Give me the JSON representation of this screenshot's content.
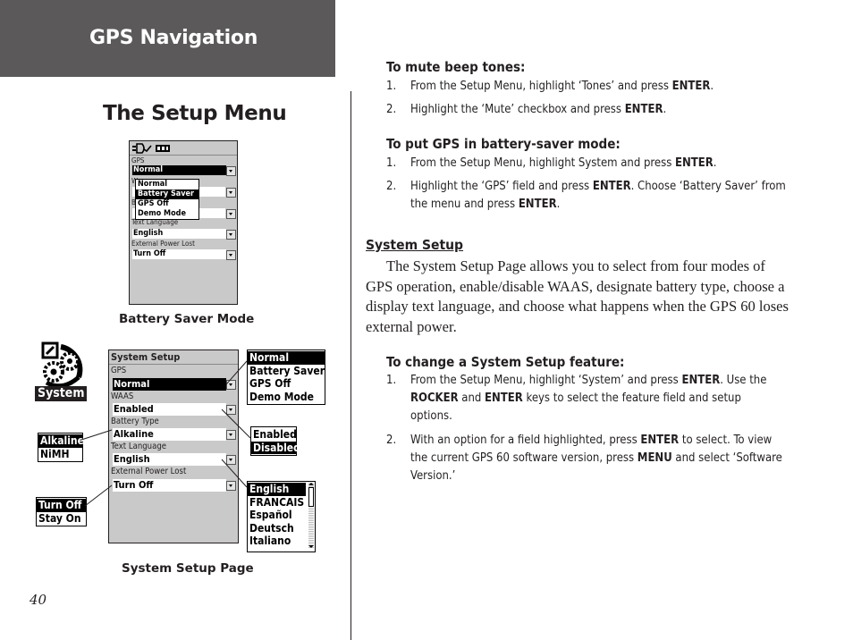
{
  "header": {
    "chapter_title": "GPS Navigation"
  },
  "section": {
    "title": "The Setup Menu"
  },
  "figure_battery": {
    "caption": "Battery Saver Mode",
    "status_icons": "signal-and-battery-icons",
    "fields": [
      {
        "label": "GPS",
        "value": "Normal",
        "selected": true
      },
      {
        "label": "WAAS",
        "value": ""
      },
      {
        "label": "Battery Type",
        "value": ""
      },
      {
        "label": "Text Language",
        "value": "English"
      },
      {
        "label": "External Power Lost",
        "value": "Turn Off"
      }
    ],
    "popup_options": [
      "Normal",
      "Battery Saver",
      "GPS Off",
      "Demo Mode"
    ],
    "popup_selected": "Battery Saver"
  },
  "figure_system": {
    "caption": "System Setup Page",
    "icon_label": "System",
    "screen_title": "System Setup",
    "fields": [
      {
        "label": "GPS",
        "value": "Normal",
        "selected": true
      },
      {
        "label": "WAAS",
        "value": "Enabled"
      },
      {
        "label": "Battery Type",
        "value": "Alkaline"
      },
      {
        "label": "Text Language",
        "value": "English"
      },
      {
        "label": "External Power Lost",
        "value": "Turn Off"
      }
    ],
    "callouts": {
      "gps": {
        "options": [
          "Normal",
          "Battery Saver",
          "GPS Off",
          "Demo Mode"
        ],
        "selected": "Normal"
      },
      "waas": {
        "options": [
          "Enabled",
          "Disabled"
        ],
        "selected": "Disabled"
      },
      "battery": {
        "options": [
          "Alkaline",
          "NiMH"
        ],
        "selected": "Alkaline"
      },
      "language": {
        "options": [
          "English",
          "FRANCAIS",
          "Español",
          "Deutsch",
          "Italiano"
        ],
        "selected": "English"
      },
      "power": {
        "options": [
          "Turn Off",
          "Stay On"
        ],
        "selected": "Turn Off"
      }
    }
  },
  "page_number": "40",
  "mute": {
    "heading": "To mute beep tones:",
    "steps": [
      {
        "n": "1.",
        "html": "From the Setup Menu, highlight ‘Tones’ and press <b>ENTER</b>."
      },
      {
        "n": "2.",
        "html": "Highlight the ‘Mute’ checkbox and press <b>ENTER</b>."
      }
    ]
  },
  "battery_saver": {
    "heading": "To put GPS in battery-saver mode:",
    "steps": [
      {
        "n": "1.",
        "html": "From the Setup Menu, highlight System and press <b>ENTER</b>."
      },
      {
        "n": "2.",
        "html": "Highlight the ‘GPS’ field and press <b>ENTER</b>. Choose ‘Battery Saver’ from the menu and press <b>ENTER</b>."
      }
    ]
  },
  "system_setup": {
    "heading": "System Setup",
    "paragraph": "The System Setup Page allows you to select from four modes of GPS operation, enable/disable WAAS, designate battery type, choose a display text language, and choose what happens when the GPS 60 loses external power."
  },
  "change_feature": {
    "heading": "To change a System Setup feature:",
    "steps": [
      {
        "n": "1.",
        "html": "From the Setup Menu, highlight ‘System’ and press <b>ENTER</b>. Use the <b>ROCKER</b> and <b>ENTER</b> keys to select the feature field and setup options."
      },
      {
        "n": "2.",
        "html": "With an option for a field highlighted, press <b>ENTER</b> to select. To view the current GPS 60 software version, press <b>MENU</b> and select ‘Software Version.’"
      }
    ]
  }
}
